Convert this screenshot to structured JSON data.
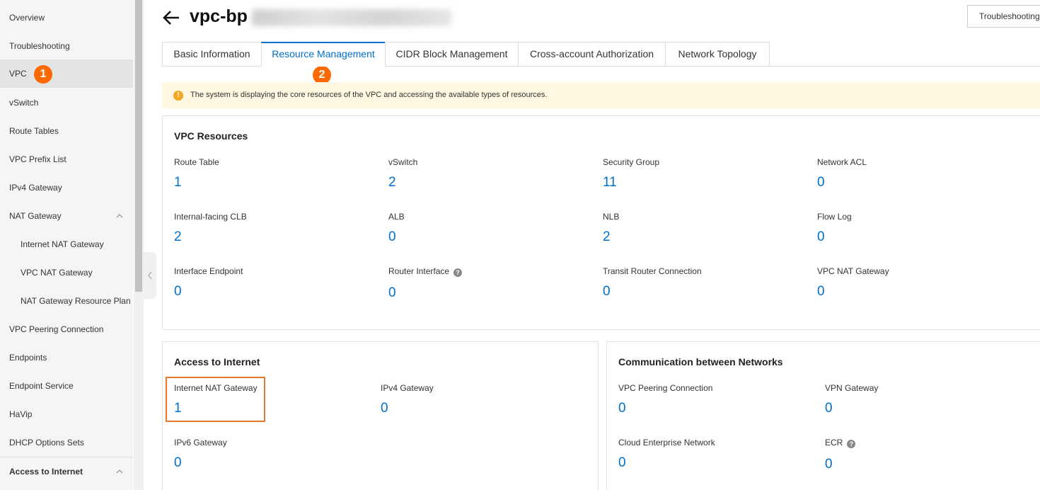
{
  "sidebar": {
    "items": [
      {
        "label": "Overview"
      },
      {
        "label": "Troubleshooting"
      },
      {
        "label": "VPC"
      },
      {
        "label": "vSwitch"
      },
      {
        "label": "Route Tables"
      },
      {
        "label": "VPC Prefix List"
      },
      {
        "label": "IPv4 Gateway"
      },
      {
        "label": "NAT Gateway"
      },
      {
        "label": "Internet NAT Gateway"
      },
      {
        "label": "VPC NAT Gateway"
      },
      {
        "label": "NAT Gateway Resource Plan"
      },
      {
        "label": "VPC Peering Connection"
      },
      {
        "label": "Endpoints"
      },
      {
        "label": "Endpoint Service"
      },
      {
        "label": "HaVip"
      },
      {
        "label": "DHCP Options Sets"
      },
      {
        "label": "Access to Internet"
      }
    ]
  },
  "badges": {
    "step1": "1",
    "step2": "2"
  },
  "header": {
    "title": "vpc-bp",
    "troubleshooting_label": "Troubleshooting"
  },
  "tabs": [
    {
      "label": "Basic Information"
    },
    {
      "label": "Resource Management"
    },
    {
      "label": "CIDR Block Management"
    },
    {
      "label": "Cross-account Authorization"
    },
    {
      "label": "Network Topology"
    }
  ],
  "notice": {
    "icon": "!",
    "text": "The system is displaying the core resources of the VPC and accessing the available types of resources."
  },
  "vpc_resources": {
    "title": "VPC Resources",
    "items": [
      {
        "label": "Route Table",
        "value": "1"
      },
      {
        "label": "vSwitch",
        "value": "2"
      },
      {
        "label": "Security Group",
        "value": "11"
      },
      {
        "label": "Network ACL",
        "value": "0"
      },
      {
        "label": "Internal-facing CLB",
        "value": "2"
      },
      {
        "label": "ALB",
        "value": "0"
      },
      {
        "label": "NLB",
        "value": "2"
      },
      {
        "label": "Flow Log",
        "value": "0"
      },
      {
        "label": "Interface Endpoint",
        "value": "0"
      },
      {
        "label": "Router Interface",
        "value": "0"
      },
      {
        "label": "Transit Router Connection",
        "value": "0"
      },
      {
        "label": "VPC NAT Gateway",
        "value": "0"
      }
    ]
  },
  "access_internet": {
    "title": "Access to Internet",
    "items": [
      {
        "label": "Internet NAT Gateway",
        "value": "1"
      },
      {
        "label": "IPv4 Gateway",
        "value": "0"
      },
      {
        "label": "IPv6 Gateway",
        "value": "0"
      }
    ]
  },
  "communication": {
    "title": "Communication between Networks",
    "items": [
      {
        "label": "VPC Peering Connection",
        "value": "0"
      },
      {
        "label": "VPN Gateway",
        "value": "0"
      },
      {
        "label": "Cloud Enterprise Network",
        "value": "0"
      },
      {
        "label": "ECR",
        "value": "0"
      }
    ]
  },
  "help_icon": "?",
  "colors": {
    "accent": "#0070cc",
    "badge": "#ff6a00",
    "highlight": "#e8772e",
    "notice_bg": "#fff7e1"
  }
}
